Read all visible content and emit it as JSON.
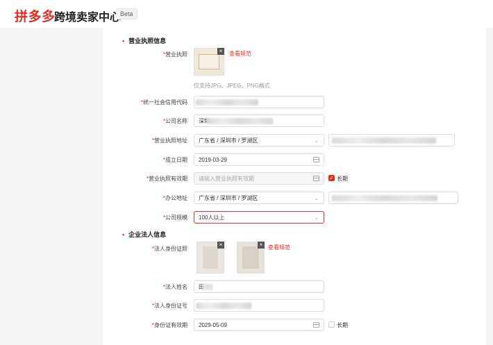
{
  "header": {
    "logo": "拼多多",
    "title": "跨境卖家中心",
    "badge": "Beta"
  },
  "business_license_section": {
    "title": "营业执照信息",
    "license_label": "营业执照",
    "license_view_spec": "查看规范",
    "license_hint": "仅支持JPG、JPEG、PNG格式",
    "credit_code_label": "统一社会信用代码",
    "company_name_label": "公司名称",
    "company_name_value": "深圳",
    "license_address_label": "营业执照地址",
    "license_address_value": "广东省 / 深圳市 / 罗湖区",
    "established_label": "成立日期",
    "established_value": "2019-03-29",
    "validity_label": "营业执照有效期",
    "validity_placeholder": "请输入营业执照有效期",
    "validity_longterm_label": "长期",
    "office_address_label": "办公地址",
    "office_address_value": "广东省 / 深圳市 / 罗湖区",
    "company_size_label": "公司规模",
    "company_size_value": "100人以上"
  },
  "legal_person_section": {
    "title": "企业法人信息",
    "id_photo_label": "法人身份证照",
    "id_view_spec": "查看规范",
    "name_label": "法人姓名",
    "name_value": "田",
    "id_number_label": "法人身份证号",
    "id_validity_label": "身份证有效期",
    "id_validity_value": "2029-05-09",
    "id_longterm_label": "长期"
  },
  "colors": {
    "brand": "#e02e24",
    "sidebar_bg": "#f2f3f5"
  }
}
